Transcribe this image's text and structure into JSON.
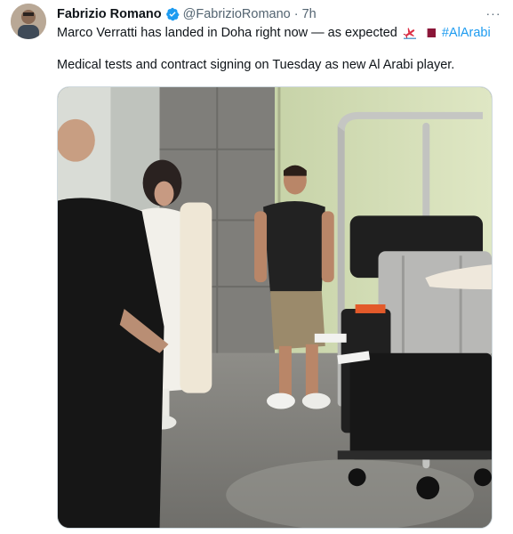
{
  "tweet": {
    "author_name": "Fabrizio Romano",
    "author_handle": "@FabrizioRomano",
    "separator": "·",
    "timestamp": "7h",
    "more_label": "···",
    "text_line1": "Marco Verratti has landed in Doha right now — as expected",
    "hashtag": "#AlArabi",
    "text_line2": "Medical tests and contract signing on Tuesday as new Al Arabi player."
  },
  "icons": {
    "verified": "verified-badge-icon",
    "more": "more-options-icon",
    "emoji_1": "airplane-departure-icon",
    "emoji_2": "qatar-flag-icon"
  },
  "colors": {
    "accent": "#1d9bf0",
    "secondary_text": "#536471",
    "primary_text": "#0f1419",
    "qatar_maroon": "#8a1538"
  }
}
